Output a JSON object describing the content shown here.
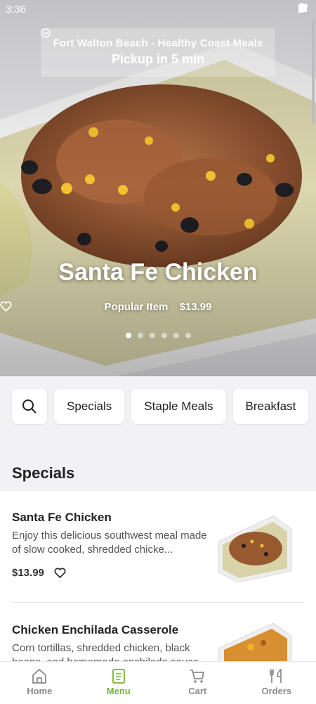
{
  "status_bar": {
    "time": "3:36"
  },
  "store_banner": {
    "store": "Fort Walton Beach - Healthy Coast Meals",
    "pickup": "Pickup in 5 min"
  },
  "hero": {
    "title": "Santa Fe Chicken",
    "tag": "Popular Item",
    "price": "$13.99",
    "slide_count": 6,
    "active_slide": 0
  },
  "categories": {
    "search_icon": "search-icon",
    "items": [
      "Specials",
      "Staple Meals",
      "Breakfast"
    ]
  },
  "section": {
    "title": "Specials"
  },
  "menu_items": [
    {
      "name": "Santa Fe Chicken",
      "description": "Enjoy this delicious southwest meal made of slow cooked, shredded chicke...",
      "price": "$13.99"
    },
    {
      "name": "Chicken Enchilada Casserole",
      "description": "Corn tortillas, shredded chicken, black beans, and homemade enchilada sauce"
    }
  ],
  "bottom_nav": [
    {
      "label": "Home",
      "icon": "home-icon"
    },
    {
      "label": "Menu",
      "icon": "menu-icon",
      "active": true
    },
    {
      "label": "Cart",
      "icon": "cart-icon"
    },
    {
      "label": "Orders",
      "icon": "orders-icon"
    }
  ],
  "colors": {
    "accent": "#7ab32e",
    "background": "#f2f2f4"
  }
}
